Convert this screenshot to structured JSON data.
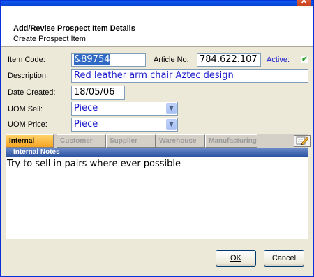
{
  "window": {
    "close_glyph": "X"
  },
  "header": {
    "title": "Add/Revise Prospect Item Details",
    "subtitle": "Create Prospect Item"
  },
  "form": {
    "item_code_label": "Item Code:",
    "item_code_value": "&89754",
    "article_no_label": "Article No:",
    "article_no_value": "784.622.107",
    "active_label": "Active:",
    "active_checked": true,
    "description_label": "Description:",
    "description_value": "Red leather arm chair Aztec design",
    "date_created_label": "Date Created:",
    "date_created_value": "18/05/06",
    "uom_sell_label": "UOM Sell:",
    "uom_sell_value": "Piece",
    "uom_price_label": "UOM Price:",
    "uom_price_value": "Piece"
  },
  "tabs": [
    {
      "label": "Internal",
      "active": true
    },
    {
      "label": "Customer",
      "active": false
    },
    {
      "label": "Supplier",
      "active": false
    },
    {
      "label": "Warehouse",
      "active": false
    },
    {
      "label": "Manufacturing",
      "active": false
    }
  ],
  "notes": {
    "header": "Internal Notes",
    "text": "Try to sell in pairs where ever possible"
  },
  "buttons": {
    "ok": "OK",
    "cancel": "Cancel"
  },
  "icons": {
    "edit": "pencil-icon",
    "dropdown": "chevron-down-icon",
    "checkbox": "checkmark-icon"
  },
  "colors": {
    "title_bar": "#0a4fe0",
    "notes_header": "#254e9e",
    "active_tab": "#f5a524",
    "value_text": "#1a1acc"
  }
}
